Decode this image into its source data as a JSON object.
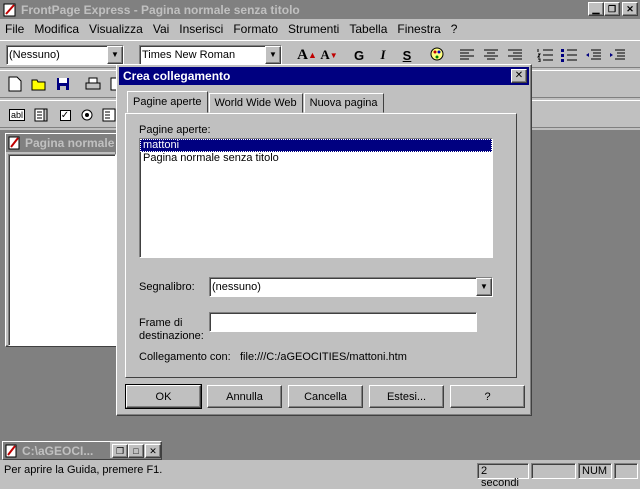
{
  "window": {
    "title": "FrontPage Express - Pagina normale senza titolo"
  },
  "menu": [
    "File",
    "Modifica",
    "Visualizza",
    "Vai",
    "Inserisci",
    "Formato",
    "Strumenti",
    "Tabella",
    "Finestra",
    "?"
  ],
  "format_toolbar": {
    "style_value": "(Nessuno)",
    "font_value": "Times New Roman"
  },
  "doc_window": {
    "title": "Pagina normale"
  },
  "min_window": {
    "title": "C:\\aGEOCI..."
  },
  "statusbar": {
    "help_text": "Per aprire la Guida, premere F1.",
    "time": "2 secondi",
    "num": "NUM"
  },
  "dialog": {
    "title": "Crea collegamento",
    "tabs": [
      "Pagine aperte",
      "World Wide Web",
      "Nuova pagina"
    ],
    "open_pages_label": "Pagine aperte:",
    "open_pages": [
      "mattoni",
      "Pagina normale senza titolo"
    ],
    "bookmark_label": "Segnalibro:",
    "bookmark_value": "(nessuno)",
    "target_frame_label_1": "Frame di",
    "target_frame_label_2": "destinazione:",
    "target_frame_value": "",
    "link_label": "Collegamento con:",
    "link_value": "file:///C:/aGEOCITIES/mattoni.htm",
    "buttons": {
      "ok": "OK",
      "cancel": "Annulla",
      "clear": "Cancella",
      "extended": "Estesi...",
      "help": "?"
    }
  }
}
